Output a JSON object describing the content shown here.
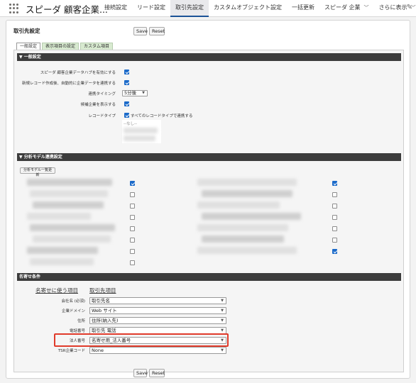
{
  "topbar": {
    "app_name": "スピーダ 顧客企業...",
    "nav": [
      {
        "label": "接続設定",
        "chevron": false
      },
      {
        "label": "リード設定",
        "chevron": false
      },
      {
        "label": "取引先設定",
        "chevron": false
      },
      {
        "label": "カスタムオブジェクト設定",
        "chevron": false
      },
      {
        "label": "一括更新",
        "chevron": false
      },
      {
        "label": "スピーダ 企業",
        "chevron": true
      },
      {
        "label": "さらに表示",
        "chevron": true
      }
    ],
    "active_index": 2
  },
  "panel": {
    "title": "取引先設定",
    "save_label": "Save",
    "reset_label": "Reset"
  },
  "tabs": [
    "一般設定",
    "表示項目の設定",
    "カスタム項目"
  ],
  "general": {
    "section_title": "▼ 一般設定",
    "rows": [
      {
        "label": "スピーダ 顧客企業データハブを有効にする",
        "checked": true
      },
      {
        "label": "新規レコード作成後、自動的に企業データを連携する",
        "checked": true
      }
    ],
    "timing_label": "連携タイミング",
    "timing_value": "5分後",
    "candidates_label": "候補企業を表示する",
    "candidates_checked": true,
    "record_type_label": "レコードタイプ",
    "record_type_checked": true,
    "record_type_text": "すべてのレコードタイプで連携する",
    "record_type_list_first": "--なし--"
  },
  "analysis": {
    "section_title": "▼ 分析モデル連携設定",
    "refresh_button": "分析モデル一覧更新",
    "left_checks": [
      true,
      false,
      false,
      false,
      false,
      false,
      false,
      false
    ],
    "right_checks": [
      true,
      false,
      false,
      false,
      false,
      false,
      true
    ]
  },
  "matching": {
    "section_title": "名寄せ条件",
    "col1_header": "名寄せに使う項目",
    "col2_header": "取引先項目",
    "rows": [
      {
        "label": "会社名 (必須)",
        "value": "取引先名"
      },
      {
        "label": "企業ドメイン",
        "value": "Web サイト"
      },
      {
        "label": "住所",
        "value": "住所(納入先)"
      },
      {
        "label": "電話番号",
        "value": "取引先 電話"
      },
      {
        "label": "法人番号",
        "value": "名寄せ用_法人番号"
      },
      {
        "label": "TSR企業コード",
        "value": "None"
      }
    ]
  },
  "icons": {
    "app-launcher": "waffle-icon",
    "edit": "pencil-icon",
    "dropdown": "chevron-down-icon"
  },
  "colors": {
    "accent": "#1b6ac9",
    "section_bar": "#3c3c3c",
    "highlight": "#e03b2b"
  }
}
